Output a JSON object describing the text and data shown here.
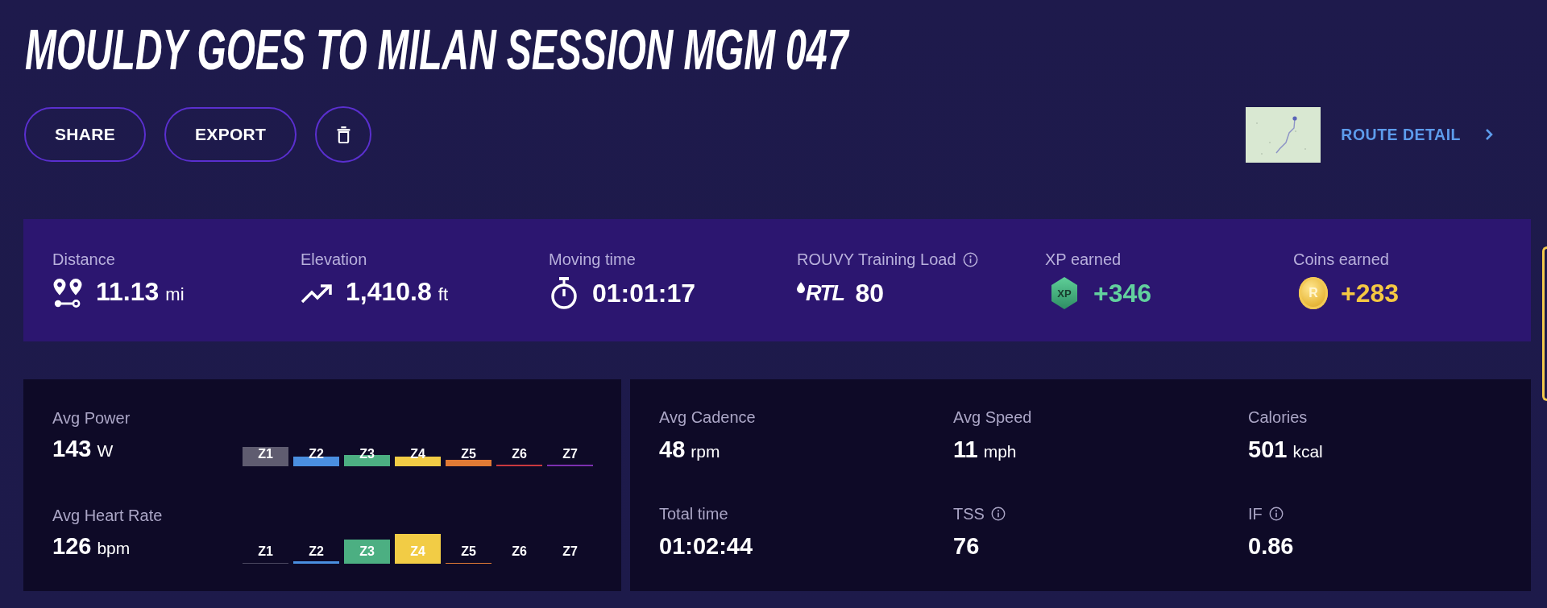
{
  "title": "MOULDY GOES TO MILAN SESSION MGM 047",
  "buttons": [
    "SHARE",
    "EXPORT"
  ],
  "route_link": {
    "label": "ROUTE DETAIL"
  },
  "summary": [
    {
      "kind": "distance",
      "label": "Distance",
      "info": false,
      "value": "11.13",
      "unit": "mi"
    },
    {
      "kind": "elevation",
      "label": "Elevation",
      "info": false,
      "value": "1,410.8",
      "unit": "ft"
    },
    {
      "kind": "moving_time",
      "label": "Moving time",
      "info": false,
      "value": "01:01:17"
    },
    {
      "kind": "training_load",
      "label": "ROUVY Training Load",
      "info": true,
      "logo": "RTL",
      "value": "80"
    },
    {
      "kind": "xp",
      "label": "XP earned",
      "info": false,
      "badge": "XP",
      "value": "+346",
      "color": "#62d09e"
    },
    {
      "kind": "coins",
      "label": "Coins earned",
      "info": false,
      "badge": "R",
      "value": "+283",
      "color": "#f5c842"
    }
  ],
  "zone_metrics": [
    {
      "label": "Avg Power",
      "value": "143",
      "unit": "W",
      "zones": [
        {
          "label": "Z1",
          "color": "#5f5c70"
        },
        {
          "label": "Z2",
          "color": "#4a8fe0"
        },
        {
          "label": "Z3",
          "color": "#4caf82"
        },
        {
          "label": "Z4",
          "color": "#f2cc45"
        },
        {
          "label": "Z5",
          "color": "#e07a35"
        },
        {
          "label": "Z6",
          "color": "#c9383f"
        },
        {
          "label": "Z7",
          "color": "#7b2fb0"
        }
      ]
    },
    {
      "label": "Avg Heart Rate",
      "value": "126",
      "unit": "bpm",
      "zones": [
        {
          "label": "Z1",
          "color": "#4a4860"
        },
        {
          "label": "Z2",
          "color": "#4a8fe0"
        },
        {
          "label": "Z3",
          "color": "#4caf82"
        },
        {
          "label": "Z4",
          "color": "#f2cc45"
        },
        {
          "label": "Z5",
          "color": "#e07a35"
        },
        {
          "label": "Z6"
        },
        {
          "label": "Z7"
        }
      ]
    }
  ],
  "metrics": [
    {
      "label": "Avg Cadence",
      "info": false,
      "value": "48",
      "unit": "rpm"
    },
    {
      "label": "Avg Speed",
      "info": false,
      "value": "11",
      "unit": "mph"
    },
    {
      "label": "Calories",
      "info": false,
      "value": "501",
      "unit": "kcal"
    },
    {
      "label": "Total time",
      "info": false,
      "value": "01:02:44"
    },
    {
      "label": "TSS",
      "info": true,
      "value": "76"
    },
    {
      "label": "IF",
      "info": true,
      "value": "0.86"
    }
  ]
}
